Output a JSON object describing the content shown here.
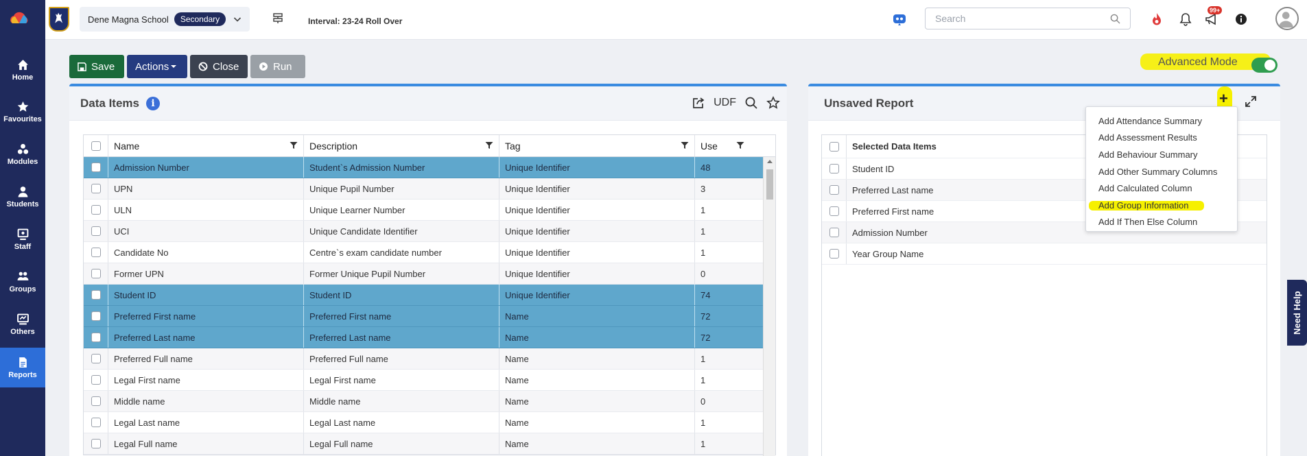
{
  "sidebar": {
    "items": [
      {
        "label": "Home"
      },
      {
        "label": "Favourites"
      },
      {
        "label": "Modules"
      },
      {
        "label": "Students"
      },
      {
        "label": "Staff"
      },
      {
        "label": "Groups"
      },
      {
        "label": "Others"
      },
      {
        "label": "Reports",
        "active": true
      }
    ]
  },
  "topbar": {
    "school_name": "Dene Magna School",
    "phase": "Secondary",
    "interval": "Interval: 23-24 Roll Over",
    "search_placeholder": "Search",
    "notifications_badge": "99+"
  },
  "toolbar": {
    "save_label": "Save",
    "actions_label": "Actions",
    "close_label": "Close",
    "run_label": "Run",
    "advanced_mode_label": "Advanced Mode",
    "advanced_mode_on": true
  },
  "data_items_panel": {
    "title": "Data Items",
    "udf_label": "UDF",
    "columns": [
      "Name",
      "Description",
      "Tag",
      "Use"
    ],
    "rows": [
      {
        "name": "Admission Number",
        "description": "Student`s Admission Number",
        "tag": "Unique Identifier",
        "use": "48",
        "selected": true
      },
      {
        "name": "UPN",
        "description": "Unique Pupil Number",
        "tag": "Unique Identifier",
        "use": "3",
        "selected": false
      },
      {
        "name": "ULN",
        "description": "Unique Learner Number",
        "tag": "Unique Identifier",
        "use": "1",
        "selected": false
      },
      {
        "name": "UCI",
        "description": "Unique Candidate Identifier",
        "tag": "Unique Identifier",
        "use": "1",
        "selected": false
      },
      {
        "name": "Candidate No",
        "description": "Centre`s exam candidate number",
        "tag": "Unique Identifier",
        "use": "1",
        "selected": false
      },
      {
        "name": "Former UPN",
        "description": "Former Unique Pupil Number",
        "tag": "Unique Identifier",
        "use": "0",
        "selected": false
      },
      {
        "name": "Student ID",
        "description": "Student ID",
        "tag": "Unique Identifier",
        "use": "74",
        "selected": true
      },
      {
        "name": "Preferred First name",
        "description": "Preferred First name",
        "tag": "Name",
        "use": "72",
        "selected": true
      },
      {
        "name": "Preferred Last name",
        "description": "Preferred Last name",
        "tag": "Name",
        "use": "72",
        "selected": true
      },
      {
        "name": "Preferred Full name",
        "description": "Preferred Full name",
        "tag": "Name",
        "use": "1",
        "selected": false
      },
      {
        "name": "Legal First name",
        "description": "Legal First name",
        "tag": "Name",
        "use": "1",
        "selected": false
      },
      {
        "name": "Middle name",
        "description": "Middle name",
        "tag": "Name",
        "use": "0",
        "selected": false
      },
      {
        "name": "Legal Last name",
        "description": "Legal Last name",
        "tag": "Name",
        "use": "1",
        "selected": false
      },
      {
        "name": "Legal Full name",
        "description": "Legal Full name",
        "tag": "Name",
        "use": "1",
        "selected": false
      }
    ]
  },
  "report_panel": {
    "title": "Unsaved Report",
    "column_header": "Selected Data Items",
    "items": [
      "Student ID",
      "Preferred Last name",
      "Preferred First name",
      "Admission Number",
      "Year Group Name"
    ]
  },
  "add_menu": {
    "items": [
      "Add Attendance Summary",
      "Add Assessment Results",
      "Add Behaviour Summary",
      "Add Other Summary Columns",
      "Add Calculated Column",
      "Add Group Information",
      "Add If Then Else Column"
    ],
    "highlighted": "Add Group Information"
  },
  "need_help_label": "Need Help",
  "colors": {
    "sidebar": "#1f2a5c",
    "active_nav": "#2d6ed8",
    "selected_row": "#5fa7cc",
    "save": "#1a6a3a",
    "highlighter": "#f6f000"
  }
}
